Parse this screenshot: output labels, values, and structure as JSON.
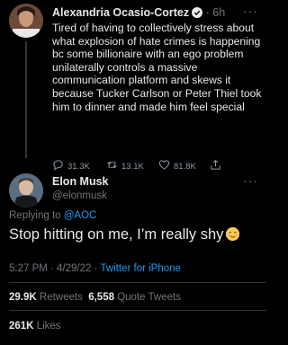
{
  "original_tweet": {
    "author_name": "Alexandria Ocasio-Cortez",
    "time_ago": "6h",
    "more": "···",
    "text": "Tired of having to collectively stress about what explosion of hate crimes is happening bc some billionaire with an ego problem unilaterally controls a massive communication platform and skews it because Tucker Carlson or Peter Thiel took him to dinner and made him feel special",
    "actions": {
      "replies": "31.3K",
      "retweets": "13.1K",
      "likes": "81.8K"
    },
    "icons": [
      "reply-icon",
      "retweet-icon",
      "like-icon",
      "share-icon"
    ]
  },
  "main_tweet": {
    "author_name": "Elon Musk",
    "handle": "@elonmusk",
    "more": "···",
    "reply_prefix": "Replying to ",
    "reply_to": "@AOC",
    "text": "Stop hitting on me, I’m really shy",
    "emoji": "smiling-face-emoji",
    "time": "5:27 PM · 4/29/22 · ",
    "source": "Twitter for iPhone",
    "retweets_count": "29.9K",
    "retweets_label": "Retweets",
    "quote_count": "6,558",
    "quote_label": "Quote Tweets",
    "likes_count": "261K",
    "likes_label": "Likes"
  },
  "colors": {
    "background": "#000000",
    "text": "#e7e9ea",
    "secondary": "#71767b",
    "accent": "#1d9bf0",
    "divider": "#2f3336"
  }
}
